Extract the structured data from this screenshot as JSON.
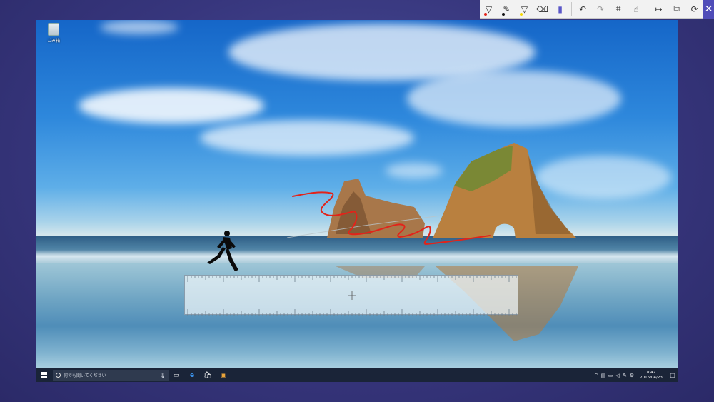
{
  "toolbar": {
    "buttons": [
      {
        "name": "ballpoint-pen-icon",
        "glyph": "▽",
        "dot": "#e2231a"
      },
      {
        "name": "pencil-icon",
        "glyph": "✎",
        "dot": "#111111"
      },
      {
        "name": "highlighter-icon",
        "glyph": "▽",
        "dot": "#f5d800"
      },
      {
        "name": "eraser-icon",
        "glyph": "⌫"
      },
      {
        "name": "ruler-icon",
        "glyph": "▮"
      },
      {
        "name": "undo-icon",
        "glyph": "↶"
      },
      {
        "name": "redo-icon",
        "glyph": "↷"
      },
      {
        "name": "crop-icon",
        "glyph": "⌗"
      },
      {
        "name": "touch-writing-icon",
        "glyph": "☝"
      },
      {
        "name": "pan-icon",
        "glyph": "↦"
      },
      {
        "name": "copy-icon",
        "glyph": "⧉"
      },
      {
        "name": "share-icon",
        "glyph": "⟳"
      }
    ],
    "close_glyph": "✕",
    "accent": "#4f4cb8"
  },
  "desktop": {
    "recycle_bin_label": "ごみ箱"
  },
  "taskbar": {
    "search_placeholder": "何でも聞いてください",
    "clock_time": "8:42",
    "clock_date": "2016/04/23"
  },
  "colors": {
    "ink": "#e2231a",
    "taskbar": "#1a2438"
  }
}
